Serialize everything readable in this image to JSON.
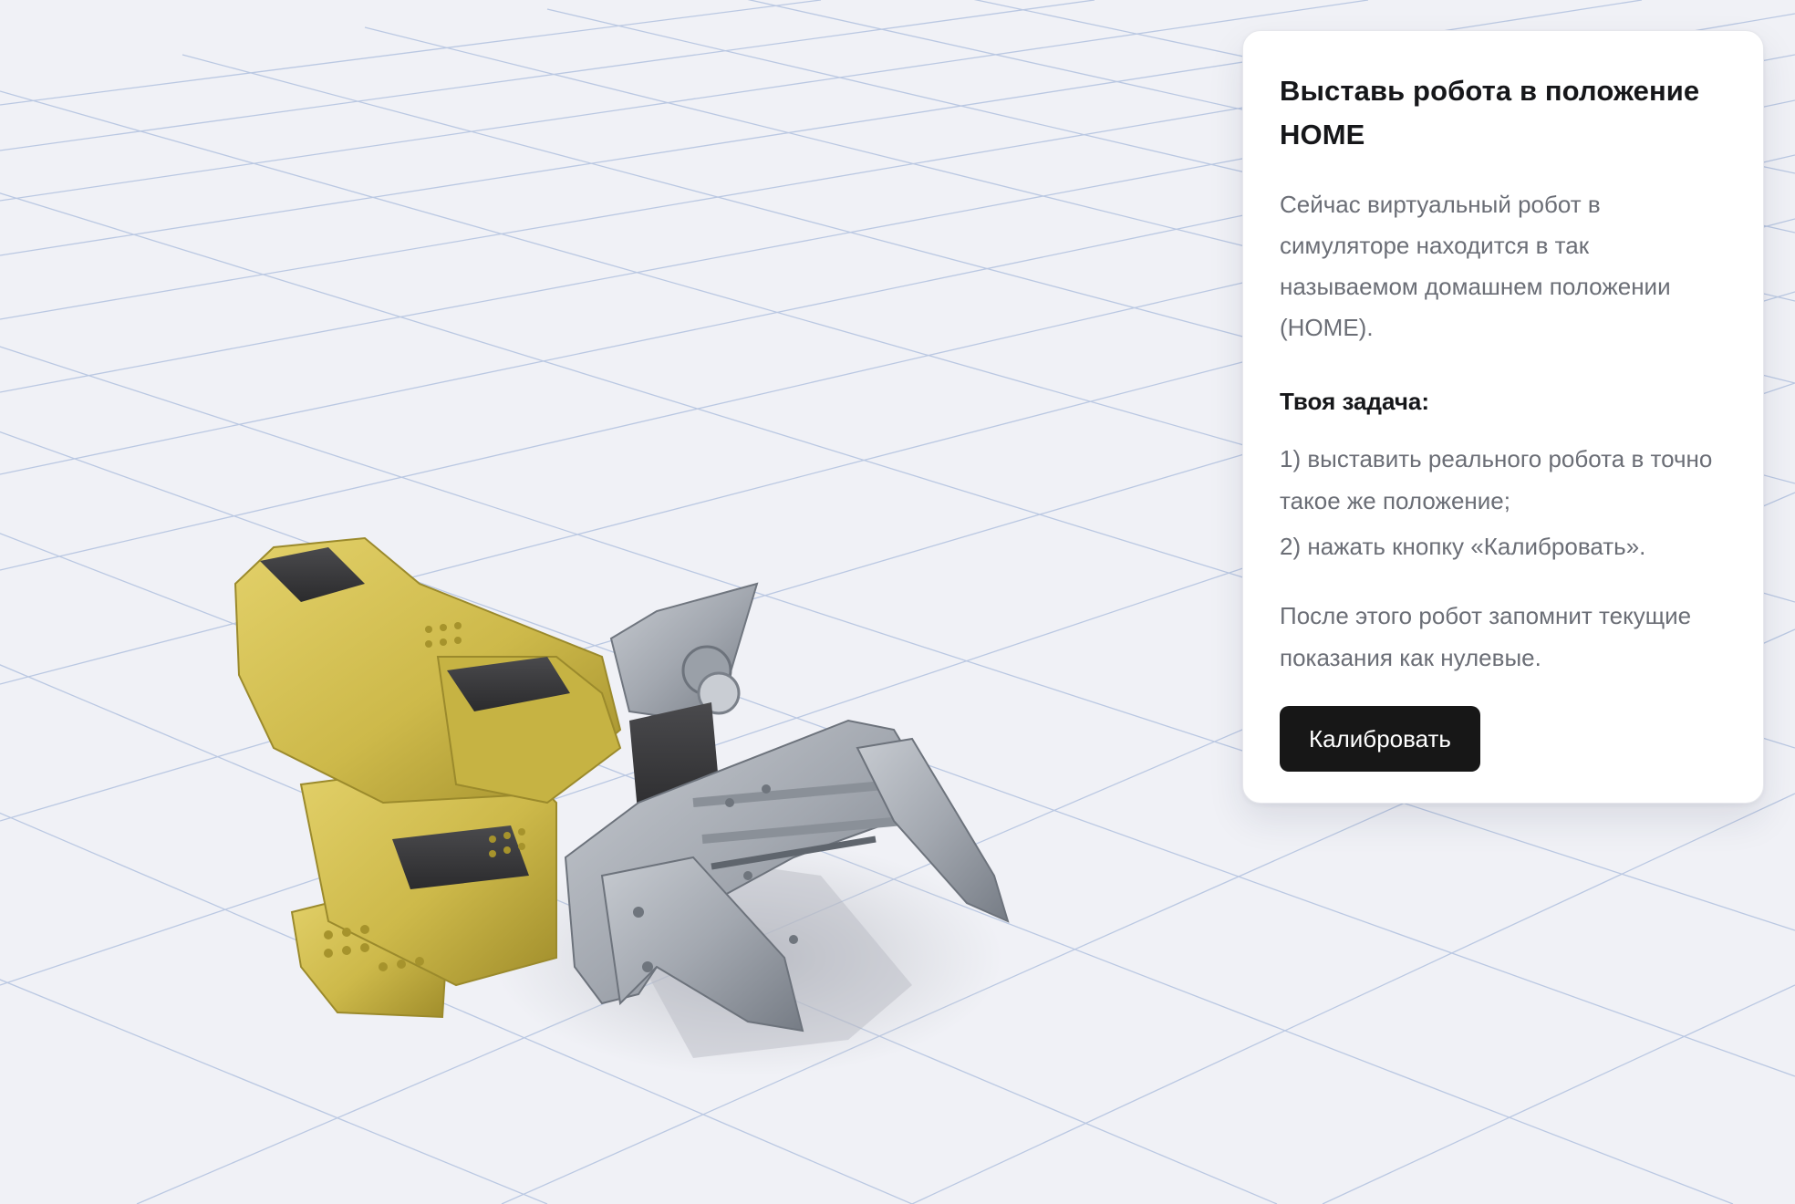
{
  "panel": {
    "title": "Выставь робота в положение HOME",
    "intro": "Сейчас виртуальный робот в симуляторе находится в так называемом домашнем положении (HOME).",
    "task_heading": "Твоя задача:",
    "steps": [
      "1) выставить реального робота в точно такое же положение;",
      "2) нажать кнопку «Калибровать»."
    ],
    "after": "После этого робот запомнит текущие показания как нулевые.",
    "calibrate_label": "Калибровать"
  },
  "scene": {
    "background_color": "#f0f1f6",
    "grid_color": "#9fb3d8",
    "robot_colors": {
      "yellow": "#d3c04f",
      "yellow_shade": "#a9962e",
      "motor": "#3b3b3d",
      "aluminum": "#a3a8b0",
      "aluminum_dark": "#7d838c"
    }
  }
}
